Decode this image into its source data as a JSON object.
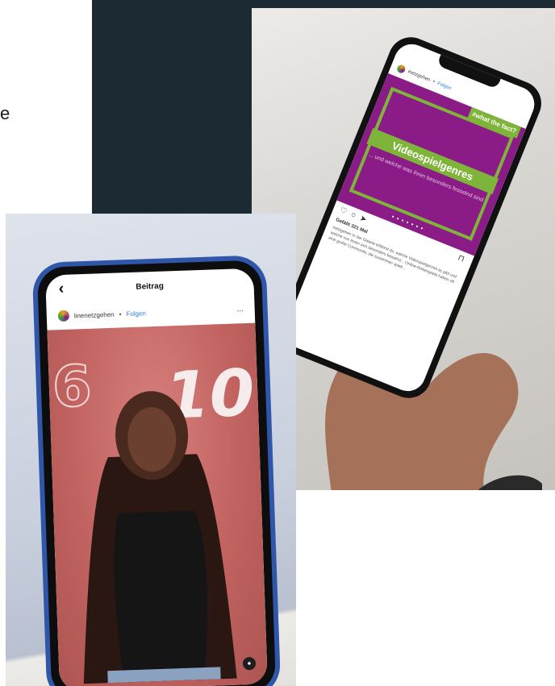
{
  "left_fragment": "e",
  "right_phone": {
    "account": "inetzgehen",
    "follow_label": "Folgen",
    "post_tag": "#what the fact?",
    "post_title": "Videospielgenres",
    "post_subtitle": "... und welche was ihren besonders fesselnd sind",
    "likes": "Gefällt 321 Mal",
    "caption": "inetzgehen In der Galerie erfährst du, welche Videospielgenres es gibt und welche von ihnen sich besonders fesselnd... Online-Rollenspiele haben oft eine große Community, die zusammen spielt..."
  },
  "left_phone": {
    "topbar_title": "Beitrag",
    "account": "linenetzgehen",
    "follow_label": "Folgen",
    "more_label": "...",
    "number_left": "6",
    "number_right": "10"
  },
  "colors": {
    "dark_panel": "#1c2a33",
    "post_purple": "#8b1b86",
    "accent_green": "#7fb43a",
    "phone_blue": "#2f56a8",
    "photo_pink": "#c26360"
  }
}
